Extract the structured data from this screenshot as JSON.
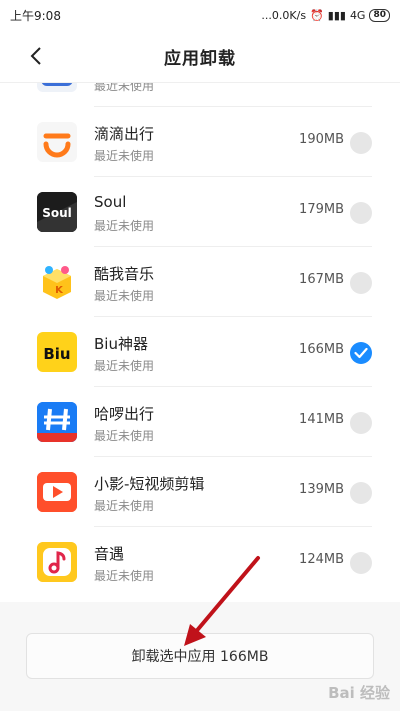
{
  "status_bar": {
    "time": "上午9:08",
    "network_speed": "...0.0K/s",
    "signal": "4G",
    "battery": "80"
  },
  "header": {
    "title": "应用卸载"
  },
  "apps": [
    {
      "name": "滴滴出行",
      "status": "最近未使用",
      "size": "190MB",
      "selected": false,
      "icon": "didi-icon"
    },
    {
      "name": "Soul",
      "status": "最近未使用",
      "size": "179MB",
      "selected": false,
      "icon": "soul-icon"
    },
    {
      "name": "酷我音乐",
      "status": "最近未使用",
      "size": "167MB",
      "selected": false,
      "icon": "kuwo-music-icon"
    },
    {
      "name": "Biu神器",
      "status": "最近未使用",
      "size": "166MB",
      "selected": true,
      "icon": "biu-icon"
    },
    {
      "name": "哈啰出行",
      "status": "最近未使用",
      "size": "141MB",
      "selected": false,
      "icon": "hellobike-icon"
    },
    {
      "name": "小影-短视频剪辑",
      "status": "最近未使用",
      "size": "139MB",
      "selected": false,
      "icon": "xiaoying-icon"
    },
    {
      "name": "音遇",
      "status": "最近未使用",
      "size": "124MB",
      "selected": false,
      "icon": "yinyu-icon"
    }
  ],
  "partial_row": {
    "status": "最近未使用"
  },
  "bottom_bar": {
    "uninstall_label": "卸载选中应用 166MB"
  },
  "watermark": "Bai 经验",
  "colors": {
    "accent": "#1a8cff",
    "annotation_arrow": "#c0121a"
  }
}
